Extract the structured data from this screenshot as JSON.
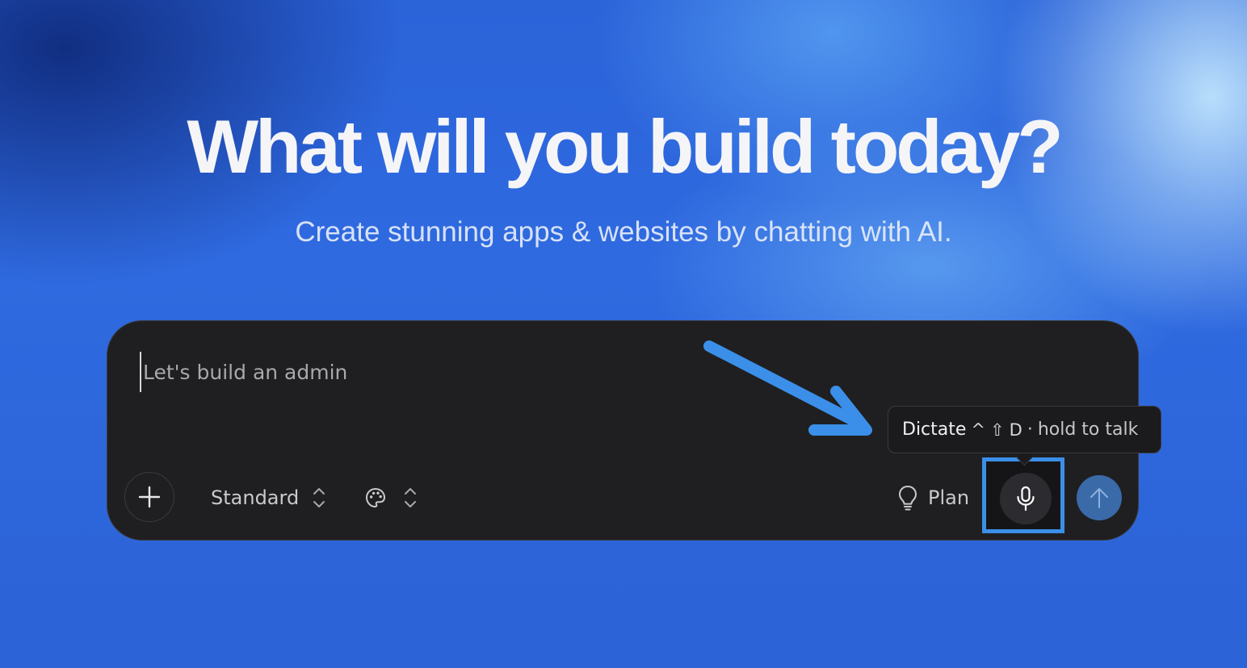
{
  "hero": {
    "title": "What will you build today?",
    "subtitle": "Create stunning apps & websites by chatting with AI."
  },
  "composer": {
    "input_value": "Let's build an admin",
    "mode_label": "Standard",
    "plan_label": "Plan",
    "icons": {
      "add": "plus-icon",
      "mode_toggle": "chevron-up-down-icon",
      "theme": "palette-icon",
      "plan": "lightbulb-icon",
      "dictate": "microphone-icon",
      "send": "arrow-up-icon"
    }
  },
  "tooltip": {
    "label": "Dictate",
    "shortcut_ctrl": "^",
    "shortcut_shift": "⇧",
    "shortcut_key": "D",
    "separator": "·",
    "hint": "hold to talk"
  },
  "colors": {
    "accent": "#3b8fe8",
    "composer_bg": "#1f1f21",
    "send_button": "#3a6aa8"
  }
}
